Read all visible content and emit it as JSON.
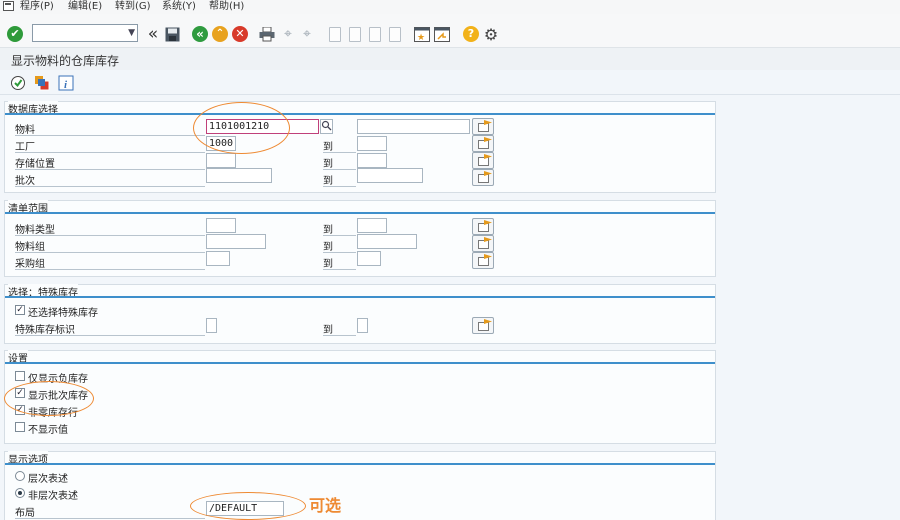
{
  "menubar": {
    "items": [
      "程序(P)",
      "编辑(E)",
      "转到(G)",
      "系统(Y)",
      "帮助(H)"
    ]
  },
  "toolbar": {
    "command_value": "",
    "icons": [
      "enter-icon",
      "back-double-arrow-icon",
      "save-icon",
      "back-icon",
      "exit-icon",
      "cancel-icon",
      "print-icon",
      "find-icon",
      "find-next-icon",
      "first-page-icon",
      "previous-page-icon",
      "next-page-icon",
      "last-page-icon",
      "new-session-icon",
      "shortcut-icon",
      "help-icon",
      "customize-layout-icon"
    ]
  },
  "title": "显示物料的仓库库存",
  "application_toolbar": {
    "icons": [
      "execute-icon",
      "get-variant-icon",
      "info-icon"
    ]
  },
  "db_selection": {
    "title": "数据库选择",
    "rows": [
      {
        "label": "物料",
        "from": "1101001210",
        "to_label": "",
        "to": ""
      },
      {
        "label": "工厂",
        "from": "1000",
        "to_label": "到",
        "to": ""
      },
      {
        "label": "存储位置",
        "from": "",
        "to_label": "到",
        "to": ""
      },
      {
        "label": "批次",
        "from": "",
        "to_label": "到",
        "to": ""
      }
    ]
  },
  "list_scope": {
    "title": "清单范围",
    "rows": [
      {
        "label": "物料类型",
        "from": "",
        "to_label": "到",
        "to": ""
      },
      {
        "label": "物料组",
        "from": "",
        "to_label": "到",
        "to": ""
      },
      {
        "label": "采购组",
        "from": "",
        "to_label": "到",
        "to": ""
      }
    ]
  },
  "special_stock": {
    "title": "选择：特殊库存",
    "checkbox_label": "还选择特殊库存",
    "checkbox_checked": true,
    "field_label": "特殊库存标识",
    "to_label": "到"
  },
  "settings": {
    "title": "设置",
    "options": [
      {
        "label": "仅显示负库存",
        "checked": false
      },
      {
        "label": "显示批次库存",
        "checked": true
      },
      {
        "label": "非零库存行",
        "checked": true
      },
      {
        "label": "不显示值",
        "checked": false
      }
    ]
  },
  "display_options": {
    "title": "显示选项",
    "radio_hier": "层次表述",
    "radio_nonhier": "非层次表述",
    "selected": "非层次表述",
    "layout_label": "布局",
    "layout_value": "/DEFAULT"
  },
  "annotation_note": "可选",
  "colors": {
    "section_line": "#3e8fcb",
    "highlight_oval": "#ee8a33",
    "enter_green": "#2e9a3a",
    "cancel_red": "#d83a2a",
    "back_green": "#2f9b3f",
    "exit_orange": "#e8a21f",
    "help_yellow": "#f2b21a"
  }
}
